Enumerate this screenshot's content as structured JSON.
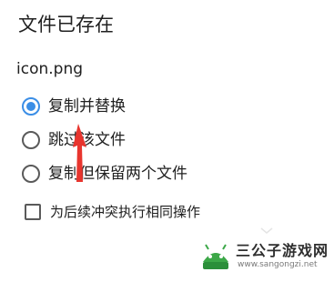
{
  "dialog": {
    "title": "文件已存在",
    "filename": "icon.png",
    "options": [
      {
        "label": "复制并替换",
        "checked": true
      },
      {
        "label": "跳过该文件",
        "checked": false
      },
      {
        "label": "复制但保留两个文件",
        "checked": false
      }
    ],
    "checkbox": {
      "label": "为后续冲突执行相同操作",
      "checked": false
    }
  },
  "colors": {
    "accent": "#3b8ee6",
    "annotation_arrow": "#e8352e"
  },
  "watermark": {
    "text": "三公子游戏网",
    "url": "www.sangongzi.net",
    "icon": "android-logo-icon"
  }
}
